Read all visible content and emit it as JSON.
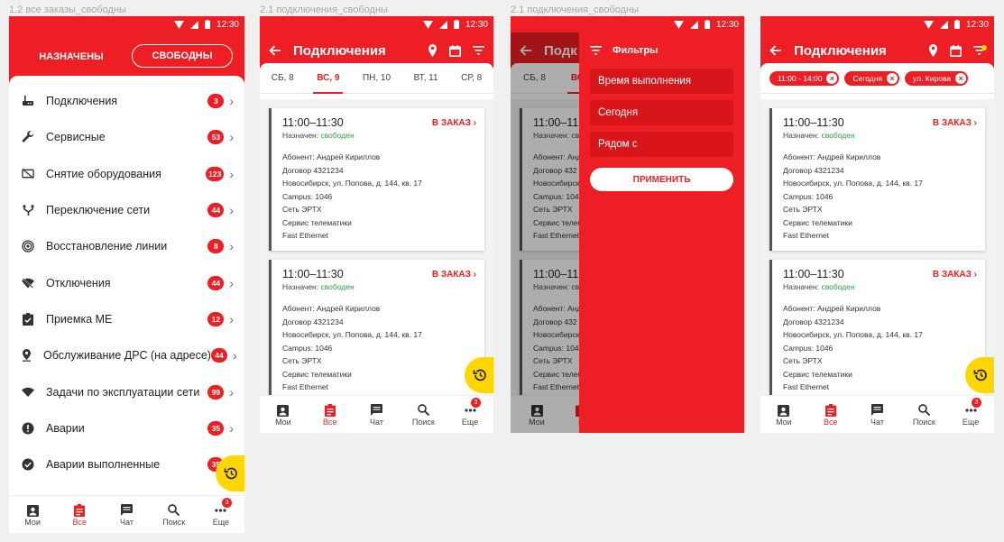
{
  "captions": [
    "1.2 все заказы_свободны",
    "2.1 подключения_свободны",
    "2.1 подключения_свободны"
  ],
  "status_time": "12:30",
  "segment": {
    "assigned": "НАЗНАЧЕНЫ",
    "free": "СВОБОДНЫ"
  },
  "menu": [
    {
      "icon": "router-icon",
      "label": "Подключения",
      "count": "3"
    },
    {
      "icon": "wrench-icon",
      "label": "Сервисные",
      "count": "53"
    },
    {
      "icon": "tv-off-icon",
      "label": "Снятие оборудования",
      "count": "123"
    },
    {
      "icon": "network-switch-icon",
      "label": "Переключение сети",
      "count": "44"
    },
    {
      "icon": "signal-icon",
      "label": "Восстановление линии",
      "count": "8"
    },
    {
      "icon": "wifi-off-icon",
      "label": "Отключения",
      "count": "44"
    },
    {
      "icon": "clipboard-check-icon",
      "label": "Приемка МЕ",
      "count": "12"
    },
    {
      "icon": "location-pin-icon",
      "label": "Обслуживание ДРС (на адресе)",
      "count": "44"
    },
    {
      "icon": "wifi-icon",
      "label": "Задачи по эксплуатации сети",
      "count": "99"
    },
    {
      "icon": "alert-icon",
      "label": "Аварии",
      "count": "35"
    },
    {
      "icon": "check-circle-icon",
      "label": "Аварии выполненные",
      "count": "35"
    }
  ],
  "nav": [
    {
      "icon": "badge-icon",
      "label": "Мои"
    },
    {
      "icon": "clipboard-icon",
      "label": "Все"
    },
    {
      "icon": "chat-icon",
      "label": "Чат"
    },
    {
      "icon": "search-icon",
      "label": "Поиск"
    },
    {
      "icon": "more-icon",
      "label": "Еще",
      "badge": "3"
    }
  ],
  "appbar_title": "Подключения",
  "days": [
    "СБ, 8",
    "ВС, 9",
    "ПН, 10",
    "ВТ, 11",
    "СР, 8"
  ],
  "order": {
    "time": "11:00–11:30",
    "assigned_label": "Назначен:",
    "assigned_value": "свободен",
    "action": "В ЗАКАЗ",
    "details": [
      "Абонент: Андрей Кириллов",
      "Договор 4321234",
      "Новосибирск, ул. Попова, д. 144, кв. 17",
      "Campus: 1046",
      "Сеть ЭРТХ",
      "Сервис телематики",
      "Fast Ethernet"
    ]
  },
  "partial": {
    "title": "Подк",
    "day_active": "ВС",
    "time": "11:00–11",
    "assigned_label": "Назначен: св",
    "details": [
      "Абонент: Анд",
      "Договор 432",
      "Новосибирск",
      "Campus: 1046",
      "Сеть ЭРТХ",
      "Сервис телем",
      "Fast Ethernet"
    ],
    "nav_label": "В"
  },
  "filters": {
    "title": "Фильтры",
    "fields": [
      "Время выполнения",
      "Сегодня",
      "Рядом с"
    ],
    "apply": "ПРИМЕНИТЬ"
  },
  "chips": [
    "11:00 - 14:00",
    "Сегодня",
    "ул. Кирова"
  ],
  "colors": {
    "brand": "#ee1f24",
    "fab": "#ffd600",
    "free": "#2ea043"
  }
}
